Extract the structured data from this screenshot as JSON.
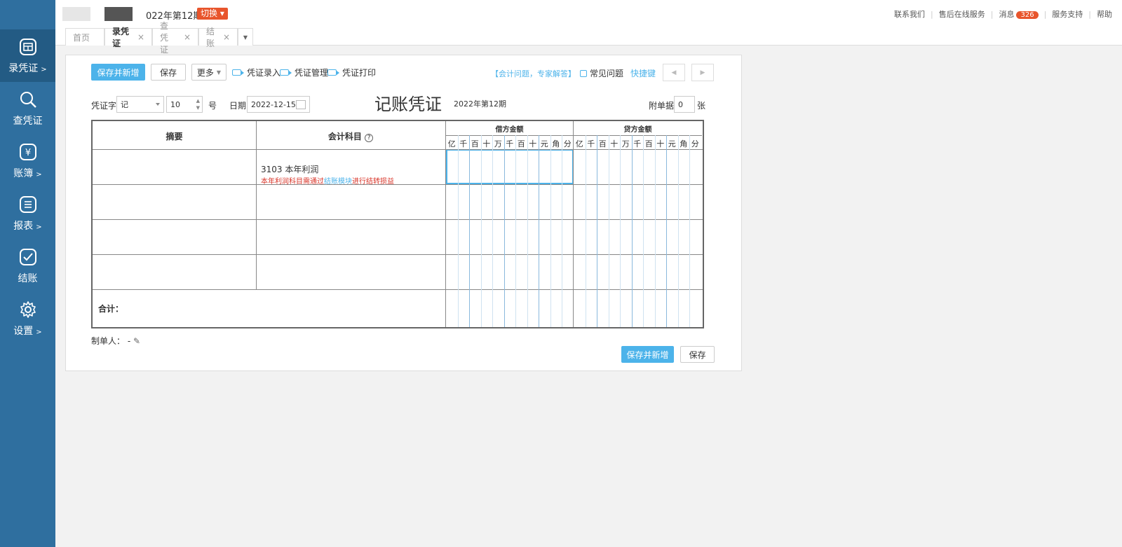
{
  "top": {
    "period": "022年第12期",
    "switch_label": "切换",
    "links": [
      "联系我们",
      "售后在线服务",
      "消息",
      "服务支持",
      "帮助"
    ],
    "message_count": "326"
  },
  "sidebar": {
    "items": [
      {
        "label": "录凭证",
        "icon": "voucher-icon",
        "arrow": ">"
      },
      {
        "label": "查凭证",
        "icon": "search-icon",
        "arrow": ""
      },
      {
        "label": "账簿",
        "icon": "yen-icon",
        "arrow": ">"
      },
      {
        "label": "报表",
        "icon": "report-icon",
        "arrow": ">"
      },
      {
        "label": "结账",
        "icon": "check-icon",
        "arrow": ""
      },
      {
        "label": "设置",
        "icon": "gear-icon",
        "arrow": ">"
      }
    ]
  },
  "tabs": [
    {
      "label": "首页",
      "closable": false
    },
    {
      "label": "录凭证",
      "closable": true,
      "active": true
    },
    {
      "label": "查凭证",
      "closable": true
    },
    {
      "label": "结账",
      "closable": true
    }
  ],
  "toolbar": {
    "save_new": "保存并新增",
    "save": "保存",
    "more": "更多",
    "voucher_entry": "凭证录入",
    "voucher_manage": "凭证管理",
    "voucher_print": "凭证打印",
    "help_link": "【会计问题，专家解答】",
    "faq": "常见问题",
    "shortcuts": "快捷键"
  },
  "form": {
    "voucher_word_label": "凭证字",
    "voucher_word": "记",
    "number": "10",
    "number_unit": "号",
    "date_label": "日期",
    "date": "2022-12-15",
    "title": "记账凭证",
    "period": "2022年第12期",
    "attach_label": "附单据",
    "attach_count": "0",
    "attach_unit": "张"
  },
  "table": {
    "col_summary": "摘要",
    "col_account": "会计科目",
    "col_debit": "借方金额",
    "col_credit": "贷方金额",
    "digits": [
      "亿",
      "千",
      "百",
      "十",
      "万",
      "千",
      "百",
      "十",
      "元",
      "角",
      "分"
    ],
    "row1_account": "3103 本年利润",
    "row1_warn_a": "本年利润科目需通过",
    "row1_warn_link": "结账模块",
    "row1_warn_b": "进行结转损益",
    "total_label": "合计："
  },
  "footer": {
    "maker_label": "制单人：",
    "maker_value": "-",
    "save_new": "保存并新增",
    "save": "保存"
  }
}
